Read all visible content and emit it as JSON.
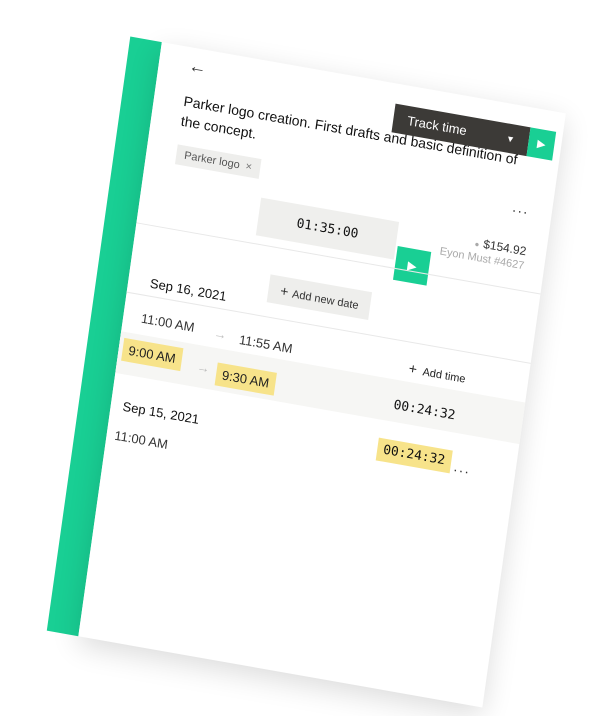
{
  "header": {
    "back_icon": "arrow-left-icon",
    "track_button_label": "Track time",
    "track_caret_icon": "caret-down-icon",
    "track_play_icon": "play-icon"
  },
  "task": {
    "title": "Parker logo creation. First drafts and basic definition of the concept.",
    "more_icon": "more-horizontal-icon",
    "tag_label": "Parker logo",
    "tag_close": "×"
  },
  "summary": {
    "price": "$154.92",
    "user": "Eyon Must #4627",
    "timer": "01:35:00",
    "play_icon": "play-icon"
  },
  "actions": {
    "add_new_date": "Add new date",
    "add_time": "Add time"
  },
  "entries": [
    {
      "date": "Sep 16, 2021",
      "rows": [
        {
          "start": "11:00 AM",
          "end": "11:55 AM",
          "duration": ""
        },
        {
          "start": "9:00 AM",
          "end": "9:30 AM",
          "duration": "00:24:32",
          "highlighted": true
        }
      ]
    },
    {
      "date": "Sep 15, 2021",
      "duration": "00:24:32",
      "rows": [
        {
          "start": "11:00 AM"
        }
      ]
    }
  ],
  "colors": {
    "accent": "#19cf94",
    "dark_button": "#3c3a37",
    "highlight": "#f7e38a"
  }
}
